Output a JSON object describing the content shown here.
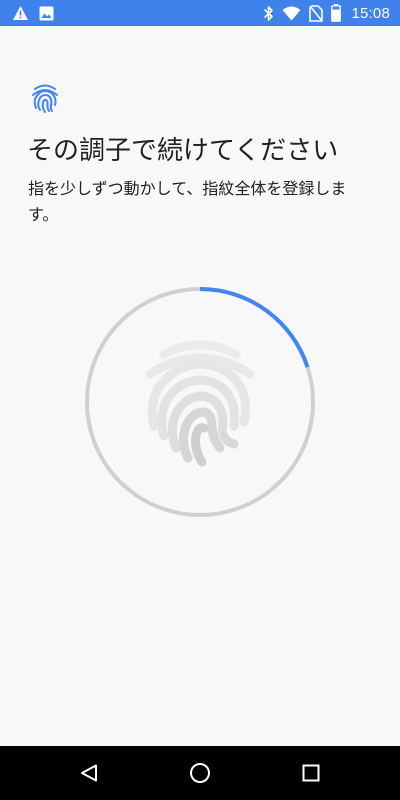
{
  "status_bar": {
    "time": "15:08",
    "left_icons": [
      "warning-icon",
      "image-icon"
    ],
    "right_icons": [
      "bluetooth-icon",
      "wifi-icon",
      "no-sim-icon",
      "battery-icon"
    ],
    "background_color": "#3f82ec"
  },
  "header": {
    "icon": "fingerprint-icon",
    "accent_color": "#4285f4"
  },
  "title": "その調子で続けてください",
  "subtitle": "指を少しずつ動かして、指紋全体を登録します。",
  "enrollment": {
    "progress_fraction": 0.2,
    "progress_color": "#4285f4",
    "track_color": "#d0d0d0",
    "icon": "fingerprint-icon"
  },
  "nav_bar": {
    "buttons": [
      "back-icon",
      "home-icon",
      "recents-icon"
    ]
  }
}
